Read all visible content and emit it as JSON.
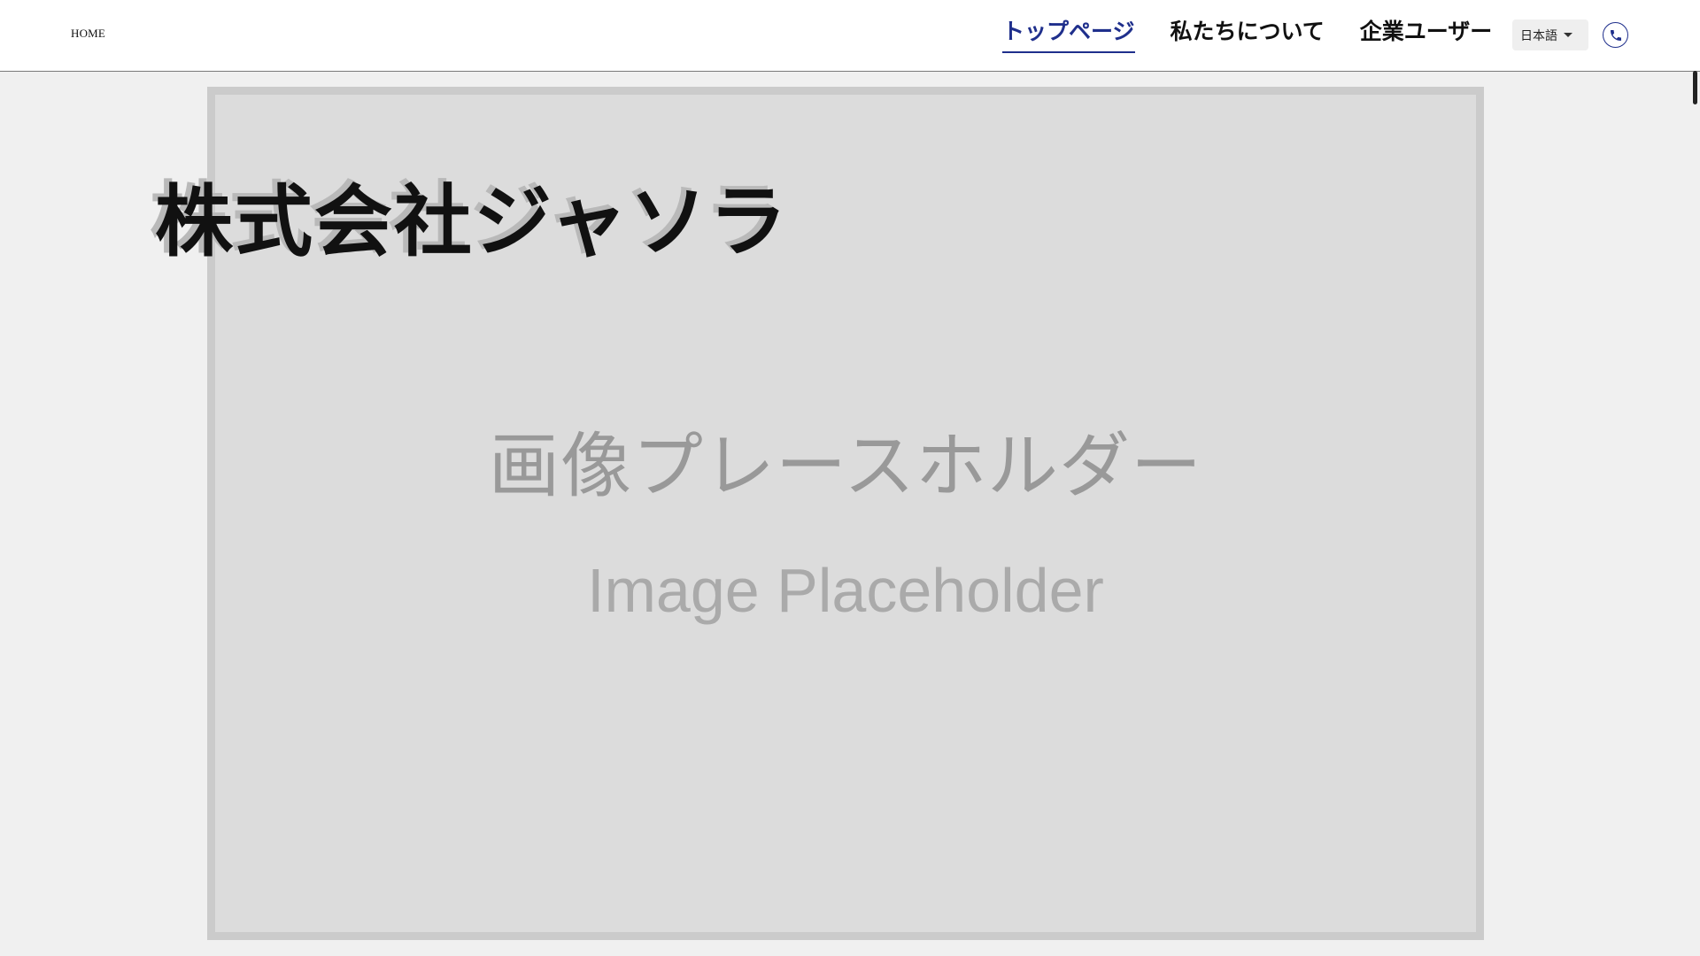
{
  "header": {
    "home_label": "HOME",
    "nav": [
      {
        "label": "トップページ",
        "active": true
      },
      {
        "label": "私たちについて",
        "active": false
      },
      {
        "label": "企業ユーザー",
        "active": false
      }
    ],
    "language": "日本語",
    "phone_icon": "phone-icon",
    "accent_color": "#1f2f8c"
  },
  "hero": {
    "company_name": "株式会社ジャソラ",
    "placeholder_jp": "画像プレースホルダー",
    "placeholder_en": "Image Placeholder"
  }
}
